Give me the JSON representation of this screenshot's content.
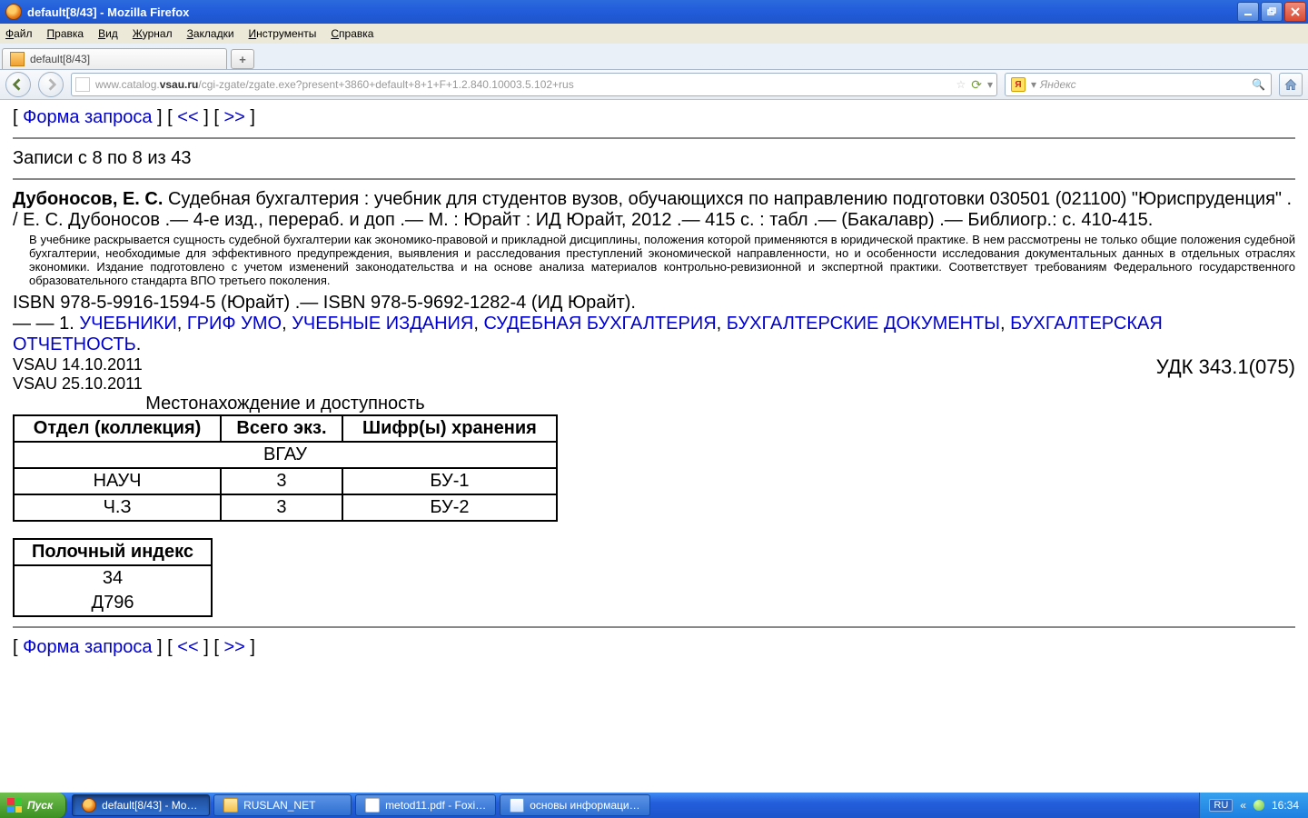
{
  "window": {
    "title": "default[8/43] - Mozilla Firefox"
  },
  "menu": {
    "file": "Файл",
    "edit": "Правка",
    "view": "Вид",
    "history": "Журнал",
    "bookmarks": "Закладки",
    "tools": "Инструменты",
    "help": "Справка"
  },
  "tab": {
    "title": "default[8/43]",
    "newtab": "+"
  },
  "addressbar": {
    "prefix": "www.catalog.",
    "host": "vsau.ru",
    "rest": "/cgi-zgate/zgate.exe?present+3860+default+8+1+F+1.2.840.10003.5.102+rus"
  },
  "search": {
    "engine_symbol": "Я",
    "placeholder": "Яндекс"
  },
  "nav": {
    "form": "Форма запроса",
    "prev": "<<",
    "next": ">>"
  },
  "records": "Записи с 8 по 8 из 43",
  "record": {
    "author": "Дубоносов, Е. С.",
    "title_long": " Судебная бухгалтерия : учебник для студентов вузов, обучающихся по направлению подготовки 030501 (021100) \"Юриспруденция\" . / Е. С. Дубоносов .— 4-е изд., перераб. и доп .— М. : Юрайт : ИД Юрайт, 2012 .— 415 с. : табл .— (Бакалавр) .— Библиогр.: с. 410-415.",
    "abstract": "В учебнике раскрывается сущность судебной бухгалтерии как экономико-правовой и прикладной дисциплины, положения которой применяются в юридической практике. В нем рассмотрены не только общие положения судебной бухгалтерии, необходимые для эффективного предупреждения, выявления и расследования преступлений экономической направленности, но и особенности исследования документальных данных в отдельных отраслях экономики. Издание подготовлено с учетом изменений законодательства и на основе анализа материалов контрольно-ревизионной и экспертной практики. Соответствует требованиям Федерального государственного образовательного стандарта ВПО третьего поколения.",
    "isbn": "ISBN 978-5-9916-1594-5 (Юрайт) .— ISBN 978-5-9692-1282-4 (ИД Юрайт).",
    "subjprefix": "— — 1. ",
    "subjects": [
      "УЧЕБНИКИ",
      "ГРИФ УМО",
      "УЧЕБНЫЕ ИЗДАНИЯ",
      "СУДЕБНАЯ БУХГАЛТЕРИЯ",
      "БУХГАЛТЕРСКИЕ ДОКУМЕНТЫ",
      "БУХГАЛТЕРСКАЯ ОТЧЕТНОСТЬ"
    ],
    "meta1": "VSAU 14.10.2011",
    "meta2": "VSAU 25.10.2011",
    "udk": "УДК 343.1(075)"
  },
  "location": {
    "heading": "Местонахождение и доступность",
    "cols": [
      "Отдел (коллекция)",
      "Всего экз.",
      "Шифр(ы) хранения"
    ],
    "group": "ВГАУ",
    "rows": [
      {
        "dept": "НАУЧ",
        "total": "3",
        "code": "БУ-1"
      },
      {
        "dept": "Ч.З",
        "total": "3",
        "code": "БУ-2"
      }
    ]
  },
  "shelf": {
    "heading": "Полочный индекс",
    "line1": "34",
    "line2": "Д796"
  },
  "taskbar": {
    "start": "Пуск",
    "items": [
      "default[8/43] - Mo…",
      "RUSLAN_NET",
      "metod11.pdf - Foxi…",
      "основы информаци…"
    ],
    "lang": "RU",
    "chev": "«",
    "clock": "16:34"
  }
}
